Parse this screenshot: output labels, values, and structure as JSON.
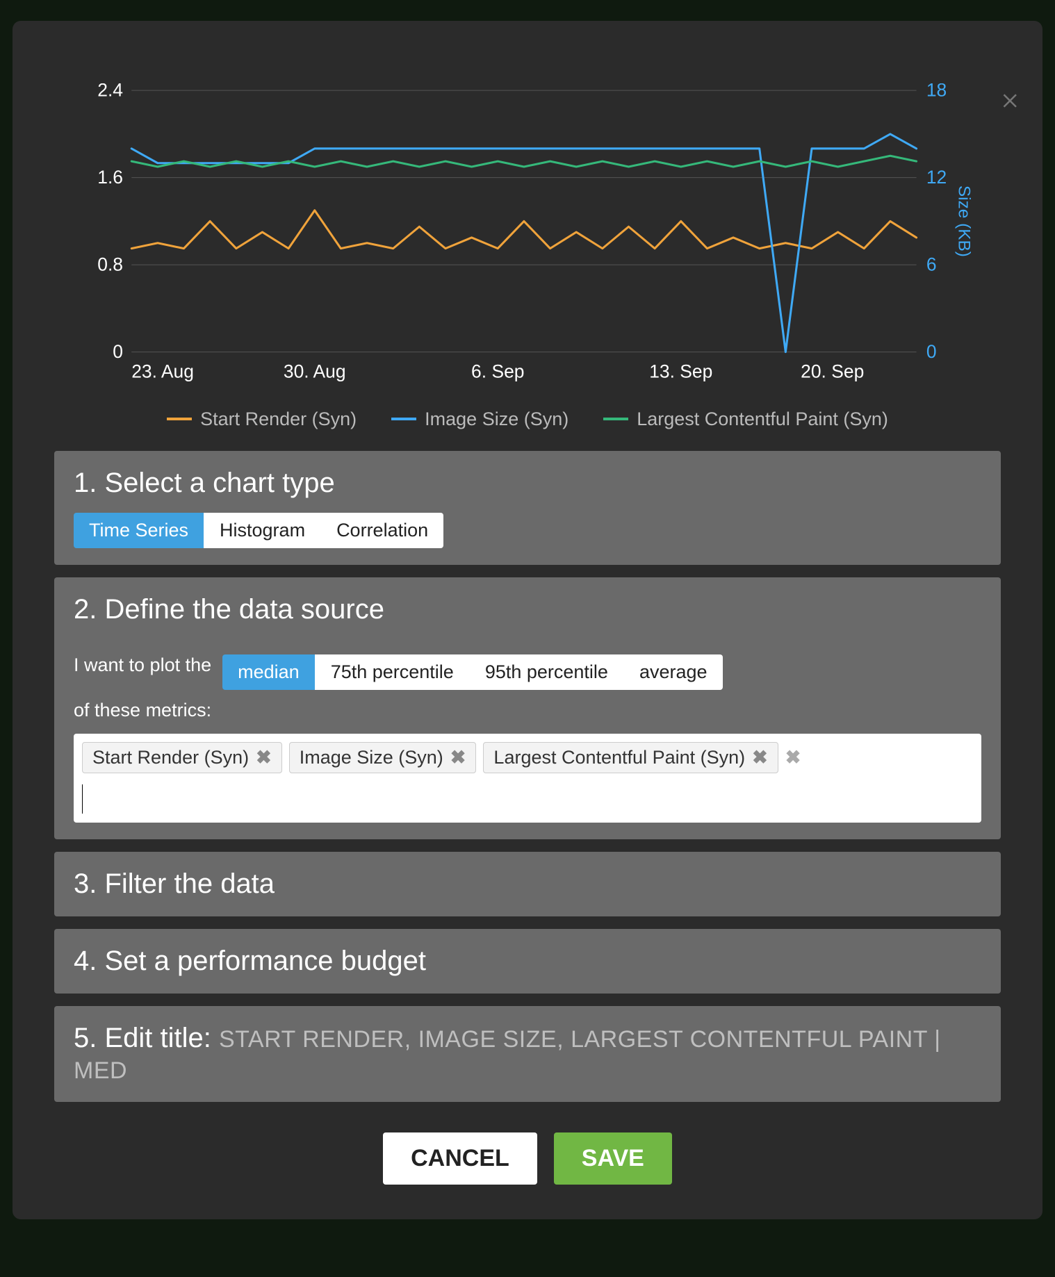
{
  "chart_data": {
    "type": "line",
    "title": "",
    "xlabel": "",
    "ylabel_left": "",
    "ylabel_right": "Size (KB)",
    "ylim_left": [
      0,
      2.4
    ],
    "ylim_right": [
      0,
      18
    ],
    "y_ticks_left": [
      0,
      0.8,
      1.6,
      2.4
    ],
    "y_ticks_right": [
      0,
      6,
      12,
      18
    ],
    "x_ticks": [
      "23. Aug",
      "30. Aug",
      "6. Sep",
      "13. Sep",
      "20. Sep"
    ],
    "legend_entries": [
      "Start Render (Syn)",
      "Image Size (Syn)",
      "Largest Contentful Paint (Syn)"
    ],
    "legend_colors": [
      "#f0a33b",
      "#3fa9f5",
      "#35b87a"
    ],
    "categories": [
      "23. Aug",
      "24. Aug",
      "25. Aug",
      "26. Aug",
      "27. Aug",
      "28. Aug",
      "29. Aug",
      "30. Aug",
      "31. Aug",
      "1. Sep",
      "2. Sep",
      "3. Sep",
      "4. Sep",
      "5. Sep",
      "6. Sep",
      "7. Sep",
      "8. Sep",
      "9. Sep",
      "10. Sep",
      "11. Sep",
      "12. Sep",
      "13. Sep",
      "14. Sep",
      "15. Sep",
      "16. Sep",
      "17. Sep",
      "18. Sep",
      "19. Sep",
      "20. Sep",
      "21. Sep",
      "22. Sep"
    ],
    "series": [
      {
        "name": "Start Render (Syn)",
        "axis": "left",
        "color": "#f0a33b",
        "values": [
          0.95,
          1.0,
          0.95,
          1.2,
          0.95,
          1.1,
          0.95,
          1.3,
          0.95,
          1.0,
          0.95,
          1.15,
          0.95,
          1.05,
          0.95,
          1.2,
          0.95,
          1.1,
          0.95,
          1.15,
          0.95,
          1.2,
          0.95,
          1.05,
          0.95,
          1.0,
          0.95,
          1.1,
          0.95,
          1.2,
          1.05
        ]
      },
      {
        "name": "Image Size (Syn)",
        "axis": "right",
        "color": "#3fa9f5",
        "values": [
          14,
          13,
          13,
          13,
          13,
          13,
          13,
          14,
          14,
          14,
          14,
          14,
          14,
          14,
          14,
          14,
          14,
          14,
          14,
          14,
          14,
          14,
          14,
          14,
          14,
          0,
          14,
          14,
          14,
          15,
          14
        ]
      },
      {
        "name": "Largest Contentful Paint (Syn)",
        "axis": "left",
        "color": "#35b87a",
        "values": [
          1.75,
          1.7,
          1.75,
          1.7,
          1.75,
          1.7,
          1.75,
          1.7,
          1.75,
          1.7,
          1.75,
          1.7,
          1.75,
          1.7,
          1.75,
          1.7,
          1.75,
          1.7,
          1.75,
          1.7,
          1.75,
          1.7,
          1.75,
          1.7,
          1.75,
          1.7,
          1.75,
          1.7,
          1.75,
          1.8,
          1.75
        ]
      }
    ]
  },
  "steps": {
    "s1": {
      "title": "1. Select a chart type",
      "options": [
        "Time Series",
        "Histogram",
        "Correlation"
      ],
      "active": "Time Series"
    },
    "s2": {
      "title": "2. Define the data source",
      "lead": "I want to plot the",
      "stat_options": [
        "median",
        "75th percentile",
        "95th percentile",
        "average"
      ],
      "stat_active": "median",
      "trail": "of these metrics:",
      "tags": [
        "Start Render (Syn)",
        "Image Size (Syn)",
        "Largest Contentful Paint (Syn)"
      ]
    },
    "s3": {
      "title": "3. Filter the data"
    },
    "s4": {
      "title": "4. Set a performance budget"
    },
    "s5": {
      "title_prefix": "5. Edit title:",
      "title_value": "START RENDER, IMAGE SIZE, LARGEST CONTENTFUL PAINT | MED"
    }
  },
  "buttons": {
    "cancel": "CANCEL",
    "save": "SAVE"
  }
}
